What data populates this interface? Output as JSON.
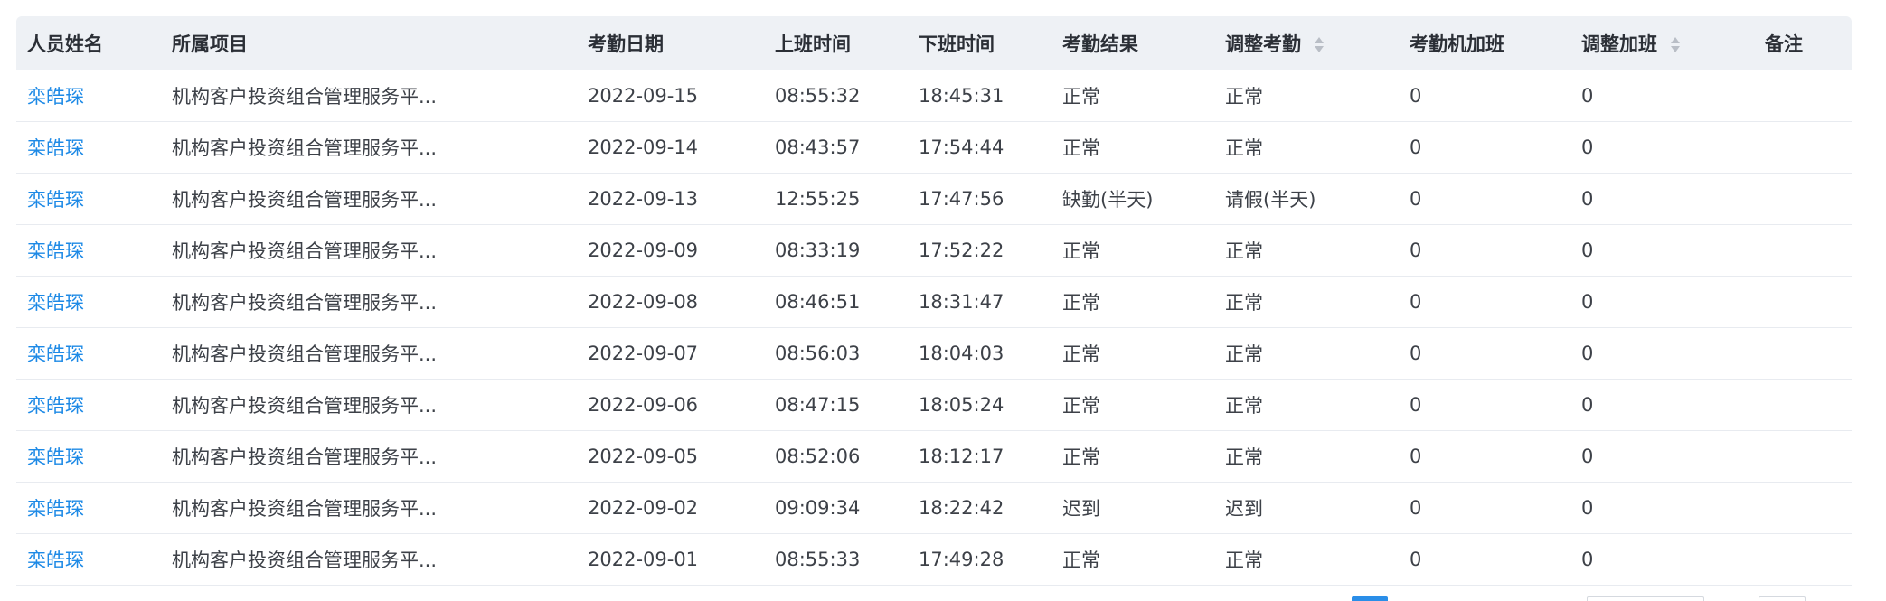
{
  "colors": {
    "link": "#1e8ae6",
    "header_bg": "#eef1f5",
    "text": "#3d4148",
    "active_page": "#2a8ee8"
  },
  "table": {
    "columns": [
      {
        "key": "name",
        "label": "人员姓名",
        "sortable": false
      },
      {
        "key": "project",
        "label": "所属项目",
        "sortable": false
      },
      {
        "key": "date",
        "label": "考勤日期",
        "sortable": false
      },
      {
        "key": "on",
        "label": "上班时间",
        "sortable": false
      },
      {
        "key": "off",
        "label": "下班时间",
        "sortable": false
      },
      {
        "key": "result",
        "label": "考勤结果",
        "sortable": false
      },
      {
        "key": "adjust",
        "label": "调整考勤",
        "sortable": true
      },
      {
        "key": "ot_machine",
        "label": "考勤机加班",
        "sortable": false
      },
      {
        "key": "ot_adjust",
        "label": "调整加班",
        "sortable": true
      },
      {
        "key": "note",
        "label": "备注",
        "sortable": false
      }
    ],
    "rows": [
      {
        "name": "栾皓琛",
        "project": "机构客户投资组合管理服务平...",
        "date": "2022-09-15",
        "on": "08:55:32",
        "off": "18:45:31",
        "result": "正常",
        "adjust": "正常",
        "ot_machine": "0",
        "ot_adjust": "0",
        "note": ""
      },
      {
        "name": "栾皓琛",
        "project": "机构客户投资组合管理服务平...",
        "date": "2022-09-14",
        "on": "08:43:57",
        "off": "17:54:44",
        "result": "正常",
        "adjust": "正常",
        "ot_machine": "0",
        "ot_adjust": "0",
        "note": ""
      },
      {
        "name": "栾皓琛",
        "project": "机构客户投资组合管理服务平...",
        "date": "2022-09-13",
        "on": "12:55:25",
        "off": "17:47:56",
        "result": "缺勤(半天)",
        "adjust": "请假(半天)",
        "ot_machine": "0",
        "ot_adjust": "0",
        "note": ""
      },
      {
        "name": "栾皓琛",
        "project": "机构客户投资组合管理服务平...",
        "date": "2022-09-09",
        "on": "08:33:19",
        "off": "17:52:22",
        "result": "正常",
        "adjust": "正常",
        "ot_machine": "0",
        "ot_adjust": "0",
        "note": ""
      },
      {
        "name": "栾皓琛",
        "project": "机构客户投资组合管理服务平...",
        "date": "2022-09-08",
        "on": "08:46:51",
        "off": "18:31:47",
        "result": "正常",
        "adjust": "正常",
        "ot_machine": "0",
        "ot_adjust": "0",
        "note": ""
      },
      {
        "name": "栾皓琛",
        "project": "机构客户投资组合管理服务平...",
        "date": "2022-09-07",
        "on": "08:56:03",
        "off": "18:04:03",
        "result": "正常",
        "adjust": "正常",
        "ot_machine": "0",
        "ot_adjust": "0",
        "note": ""
      },
      {
        "name": "栾皓琛",
        "project": "机构客户投资组合管理服务平...",
        "date": "2022-09-06",
        "on": "08:47:15",
        "off": "18:05:24",
        "result": "正常",
        "adjust": "正常",
        "ot_machine": "0",
        "ot_adjust": "0",
        "note": ""
      },
      {
        "name": "栾皓琛",
        "project": "机构客户投资组合管理服务平...",
        "date": "2022-09-05",
        "on": "08:52:06",
        "off": "18:12:17",
        "result": "正常",
        "adjust": "正常",
        "ot_machine": "0",
        "ot_adjust": "0",
        "note": ""
      },
      {
        "name": "栾皓琛",
        "project": "机构客户投资组合管理服务平...",
        "date": "2022-09-02",
        "on": "09:09:34",
        "off": "18:22:42",
        "result": "迟到",
        "adjust": "迟到",
        "ot_machine": "0",
        "ot_adjust": "0",
        "note": ""
      },
      {
        "name": "栾皓琛",
        "project": "机构客户投资组合管理服务平...",
        "date": "2022-09-01",
        "on": "08:55:33",
        "off": "17:49:28",
        "result": "正常",
        "adjust": "正常",
        "ot_machine": "0",
        "ot_adjust": "0",
        "note": ""
      }
    ]
  }
}
